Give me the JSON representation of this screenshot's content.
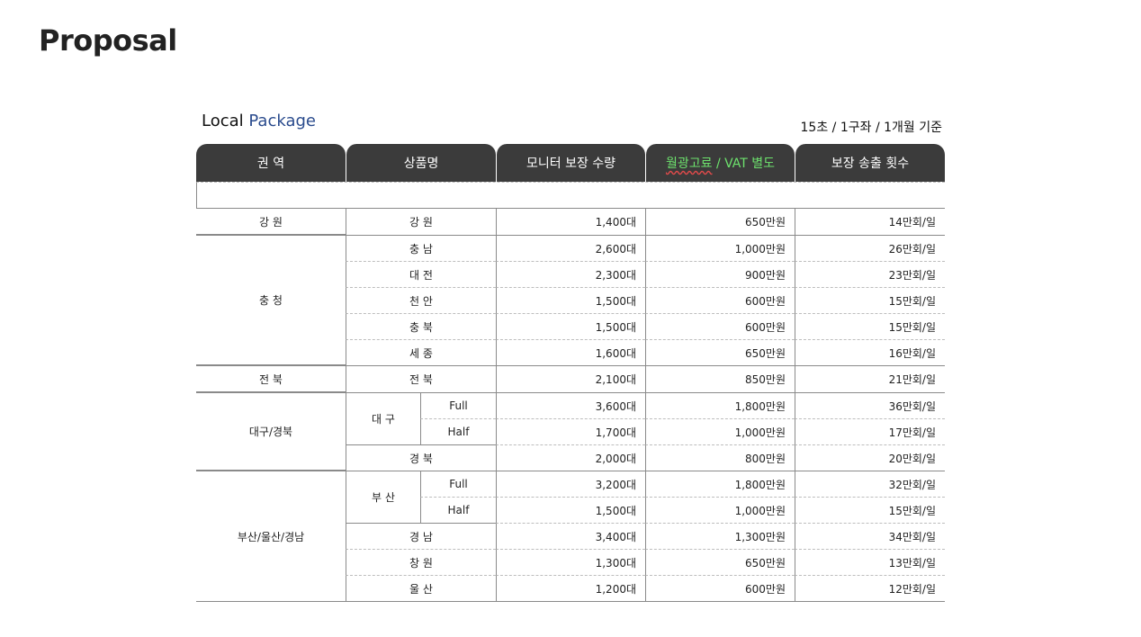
{
  "page": {
    "title": "Proposal"
  },
  "package": {
    "title_prefix": "Local",
    "title_accent": "Package",
    "basis": "15초 / 1구좌 / 1개월 기준"
  },
  "colors": {
    "header_bg": "#3b3b3b",
    "accent_blue": "#2a4b8d",
    "vat_green": "#6de26d"
  },
  "table": {
    "headers": {
      "region": "권 역",
      "product": "상품명",
      "monitors": "모니터 보장 수량",
      "price_main": "월광고료",
      "price_suffix": " / VAT 별도",
      "plays": "보장 송출 횟수"
    },
    "rows": [
      {
        "region": "강 원",
        "product": "강 원",
        "variant": "",
        "monitors": "1,400대",
        "price": "650만원",
        "plays": "14만회/일"
      },
      {
        "region": "충 청",
        "product": "충 남",
        "variant": "",
        "monitors": "2,600대",
        "price": "1,000만원",
        "plays": "26만회/일"
      },
      {
        "region": "",
        "product": "대 전",
        "variant": "",
        "monitors": "2,300대",
        "price": "900만원",
        "plays": "23만회/일"
      },
      {
        "region": "",
        "product": "천 안",
        "variant": "",
        "monitors": "1,500대",
        "price": "600만원",
        "plays": "15만회/일"
      },
      {
        "region": "",
        "product": "충 북",
        "variant": "",
        "monitors": "1,500대",
        "price": "600만원",
        "plays": "15만회/일"
      },
      {
        "region": "",
        "product": "세 종",
        "variant": "",
        "monitors": "1,600대",
        "price": "650만원",
        "plays": "16만회/일"
      },
      {
        "region": "전 북",
        "product": "전 북",
        "variant": "",
        "monitors": "2,100대",
        "price": "850만원",
        "plays": "21만회/일"
      },
      {
        "region": "대구/경북",
        "product": "대 구",
        "variant": "Full",
        "monitors": "3,600대",
        "price": "1,800만원",
        "plays": "36만회/일"
      },
      {
        "region": "",
        "product": "",
        "variant": "Half",
        "monitors": "1,700대",
        "price": "1,000만원",
        "plays": "17만회/일"
      },
      {
        "region": "",
        "product": "경 북",
        "variant": "",
        "monitors": "2,000대",
        "price": "800만원",
        "plays": "20만회/일"
      },
      {
        "region": "부산/울산/경남",
        "product": "부 산",
        "variant": "Full",
        "monitors": "3,200대",
        "price": "1,800만원",
        "plays": "32만회/일"
      },
      {
        "region": "",
        "product": "",
        "variant": "Half",
        "monitors": "1,500대",
        "price": "1,000만원",
        "plays": "15만회/일"
      },
      {
        "region": "",
        "product": "경 남",
        "variant": "",
        "monitors": "3,400대",
        "price": "1,300만원",
        "plays": "34만회/일"
      },
      {
        "region": "",
        "product": "창 원",
        "variant": "",
        "monitors": "1,300대",
        "price": "650만원",
        "plays": "13만회/일"
      },
      {
        "region": "",
        "product": "울 산",
        "variant": "",
        "monitors": "1,200대",
        "price": "600만원",
        "plays": "12만회/일"
      }
    ]
  }
}
